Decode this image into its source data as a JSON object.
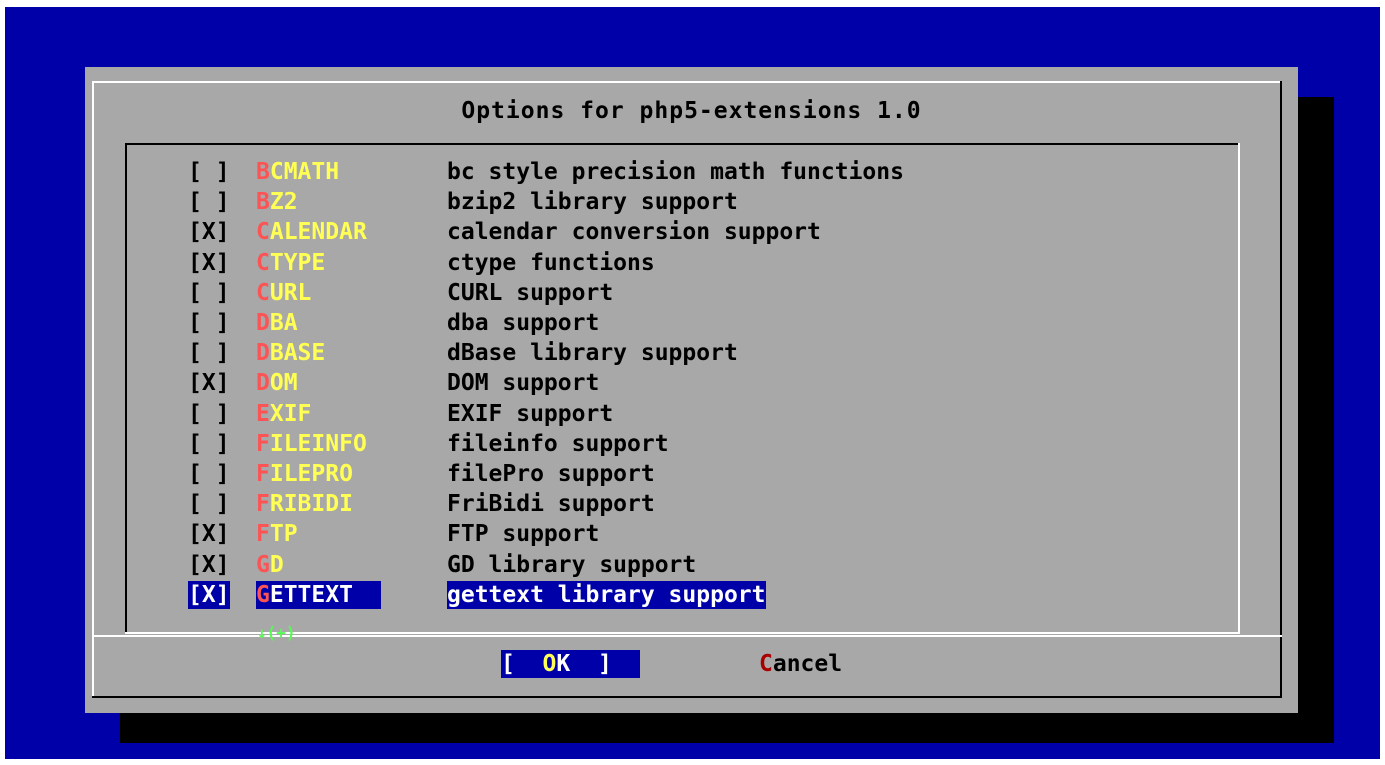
{
  "dialog": {
    "title": "Options for php5-extensions 1.0",
    "more_indicator": "↓(+)",
    "options": [
      {
        "check": "[ ]",
        "hotkey": "B",
        "rest": "CMATH",
        "desc": "bc style precision math functions"
      },
      {
        "check": "[ ]",
        "hotkey": "B",
        "rest": "Z2",
        "desc": "bzip2 library support"
      },
      {
        "check": "[X]",
        "hotkey": "C",
        "rest": "ALENDAR",
        "desc": "calendar conversion support"
      },
      {
        "check": "[X]",
        "hotkey": "C",
        "rest": "TYPE",
        "desc": "ctype functions"
      },
      {
        "check": "[ ]",
        "hotkey": "C",
        "rest": "URL",
        "desc": "CURL support"
      },
      {
        "check": "[ ]",
        "hotkey": "D",
        "rest": "BA",
        "desc": "dba support"
      },
      {
        "check": "[ ]",
        "hotkey": "D",
        "rest": "BASE",
        "desc": "dBase library support"
      },
      {
        "check": "[X]",
        "hotkey": "D",
        "rest": "OM",
        "desc": "DOM support"
      },
      {
        "check": "[ ]",
        "hotkey": "E",
        "rest": "XIF",
        "desc": "EXIF support"
      },
      {
        "check": "[ ]",
        "hotkey": "F",
        "rest": "ILEINFO",
        "desc": "fileinfo support"
      },
      {
        "check": "[ ]",
        "hotkey": "F",
        "rest": "ILEPRO",
        "desc": "filePro support"
      },
      {
        "check": "[ ]",
        "hotkey": "F",
        "rest": "RIBIDI",
        "desc": "FriBidi support"
      },
      {
        "check": "[X]",
        "hotkey": "F",
        "rest": "TP",
        "desc": "FTP support"
      },
      {
        "check": "[X]",
        "hotkey": "G",
        "rest": "D",
        "desc": "GD library support"
      },
      {
        "check": "[X]",
        "hotkey": "G",
        "rest": "ETTEXT",
        "desc": "gettext library support",
        "selected": true
      }
    ],
    "buttons": {
      "ok": {
        "left": "[  ",
        "hotkey": "O",
        "rest": "K",
        "right": "  ]"
      },
      "cancel": {
        "hotkey": "C",
        "rest": "ancel"
      }
    }
  },
  "colors": {
    "background": "#0000a8",
    "dialog": "#a8a8a8",
    "name_text": "#ffff54",
    "hotkey": "#fc5454",
    "highlight": "#0000a8"
  }
}
